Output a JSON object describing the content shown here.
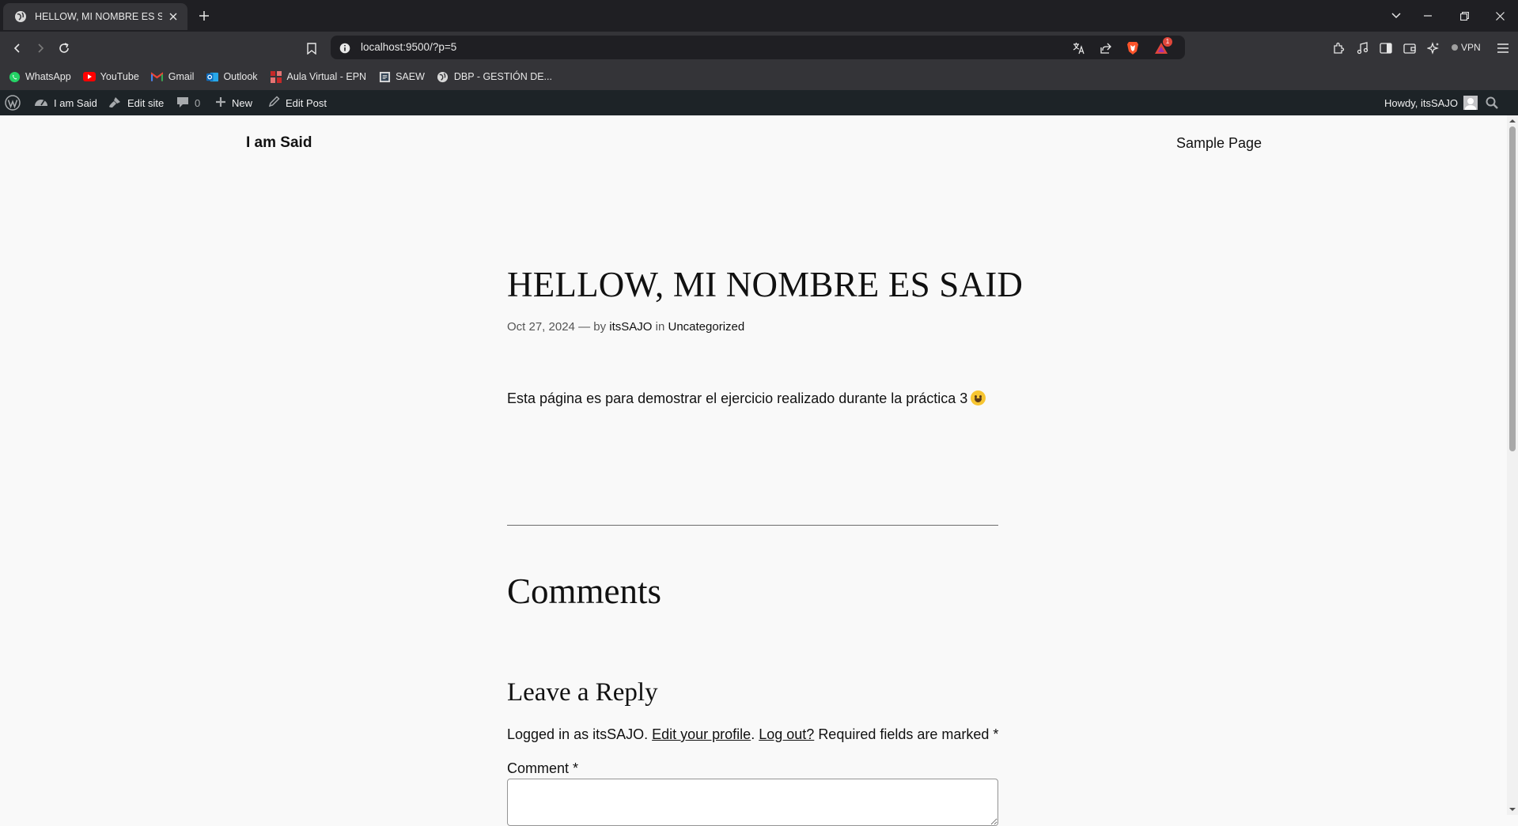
{
  "browser": {
    "tab_title": "HELLOW, MI NOMBRE ES SAID",
    "url": "localhost:9500/?p=5",
    "vpn_label": "VPN",
    "notification_count": "1",
    "bookmarks": [
      {
        "label": "WhatsApp",
        "icon": "whatsapp-icon",
        "color": "#25d366"
      },
      {
        "label": "YouTube",
        "icon": "youtube-icon",
        "color": "#ff0000"
      },
      {
        "label": "Gmail",
        "icon": "gmail-icon",
        "color": "#ea4335"
      },
      {
        "label": "Outlook",
        "icon": "outlook-icon",
        "color": "#0f6cbd"
      },
      {
        "label": "Aula Virtual - EPN",
        "icon": "aula-virtual-icon",
        "color": "#c62828"
      },
      {
        "label": "SAEW",
        "icon": "saew-icon",
        "color": "#dddddd"
      },
      {
        "label": "DBP - GESTIÓN DE...",
        "icon": "globe-icon",
        "color": "#dddddd"
      }
    ]
  },
  "adminbar": {
    "site_name": "I am Said",
    "edit_site": "Edit site",
    "comments_count": "0",
    "new_label": "New",
    "edit_post": "Edit Post",
    "howdy": "Howdy, itsSAJO"
  },
  "site": {
    "title": "I am Said",
    "nav": [
      "Sample Page"
    ]
  },
  "post": {
    "title": "HELLOW, MI NOMBRE ES SAID",
    "date": "Oct 27, 2024",
    "by_sep": "— by",
    "author": "itsSAJO",
    "in_sep": "in",
    "category": "Uncategorized",
    "body": "Esta página es para demostrar el ejercicio realizado durante la práctica 3"
  },
  "comments": {
    "heading": "Comments",
    "reply_heading": "Leave a Reply",
    "logged_in_prefix": "Logged in as itsSAJO.",
    "edit_profile": "Edit your profile",
    "period": ".",
    "log_out": "Log out?",
    "required_note": "Required fields are marked *",
    "comment_label": "Comment *"
  },
  "colors": {
    "browser_dark": "#1f1f23",
    "browser_toolbar": "#343438",
    "wp_adminbar": "#1d2327",
    "page_bg": "#f9f9f9",
    "brave_orange": "#fb542b"
  }
}
